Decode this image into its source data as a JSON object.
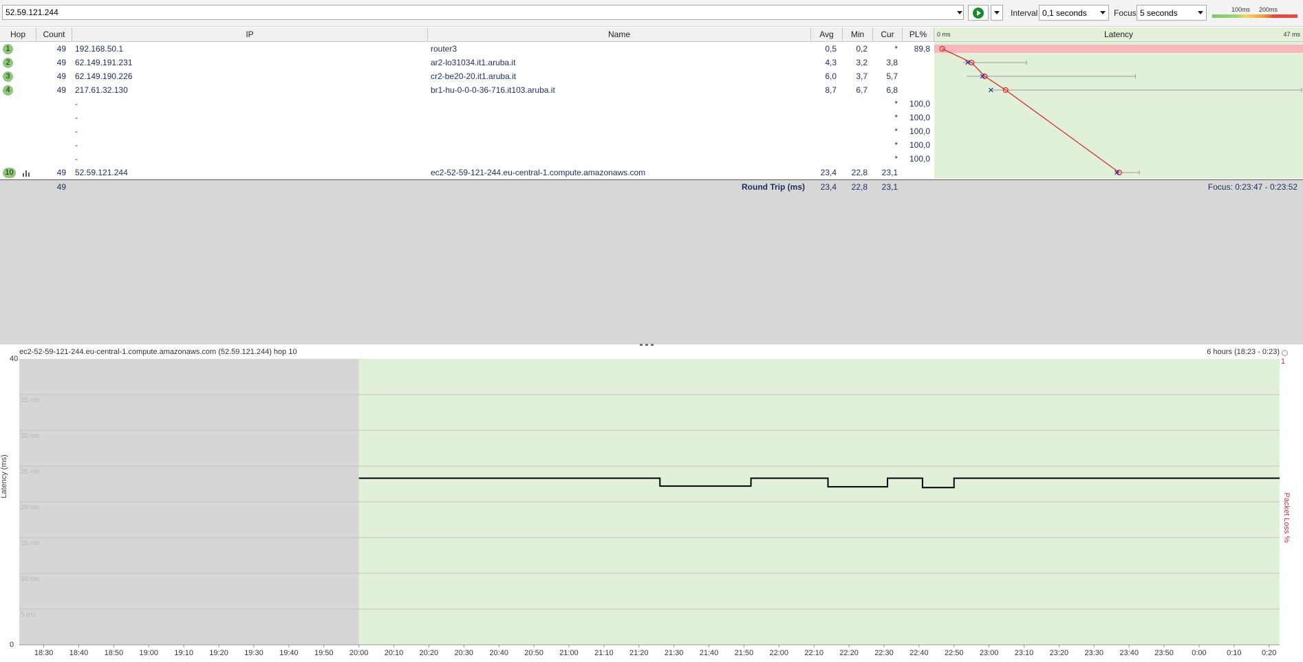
{
  "toolbar": {
    "target": "52.59.121.244",
    "interval_label": "Interval",
    "interval_value": "0,1 seconds",
    "focus_label": "Focus",
    "focus_value": "5 seconds",
    "scale_100": "100ms",
    "scale_200": "200ms",
    "play_icon": "play-icon"
  },
  "table": {
    "headers": {
      "hop": "Hop",
      "count": "Count",
      "ip": "IP",
      "name": "Name",
      "avg": "Avg",
      "min": "Min",
      "cur": "Cur",
      "pl": "PL%",
      "latency": "Latency"
    },
    "latency_scale_min": "0 ms",
    "latency_scale_max": "47 ms",
    "rows": [
      {
        "hop": "1",
        "count": "49",
        "ip": "192.168.50.1",
        "name": "router3",
        "avg": "0,5",
        "min": "0,2",
        "cur": "*",
        "pl": "89,8"
      },
      {
        "hop": "2",
        "count": "49",
        "ip": "62.149.191.231",
        "name": "ar2-lo31034.it1.aruba.it",
        "avg": "4,3",
        "min": "3,2",
        "cur": "3,8",
        "pl": ""
      },
      {
        "hop": "3",
        "count": "49",
        "ip": "62.149.190.226",
        "name": "cr2-be20-20.it1.aruba.it",
        "avg": "6,0",
        "min": "3,7",
        "cur": "5,7",
        "pl": ""
      },
      {
        "hop": "4",
        "count": "49",
        "ip": "217.61.32.130",
        "name": "br1-hu-0-0-0-36-716.it103.aruba.it",
        "avg": "8,7",
        "min": "6,7",
        "cur": "6,8",
        "pl": ""
      },
      {
        "hop": "",
        "count": "",
        "ip": "-",
        "name": "",
        "avg": "",
        "min": "",
        "cur": "*",
        "pl": "100,0"
      },
      {
        "hop": "",
        "count": "",
        "ip": "-",
        "name": "",
        "avg": "",
        "min": "",
        "cur": "*",
        "pl": "100,0"
      },
      {
        "hop": "",
        "count": "",
        "ip": "-",
        "name": "",
        "avg": "",
        "min": "",
        "cur": "*",
        "pl": "100,0"
      },
      {
        "hop": "",
        "count": "",
        "ip": "-",
        "name": "",
        "avg": "",
        "min": "",
        "cur": "*",
        "pl": "100,0"
      },
      {
        "hop": "",
        "count": "",
        "ip": "-",
        "name": "",
        "avg": "",
        "min": "",
        "cur": "*",
        "pl": "100,0"
      },
      {
        "hop": "10",
        "count": "49",
        "ip": "52.59.121.244",
        "name": "ec2-52-59-121-244.eu-central-1.compute.amazonaws.com",
        "avg": "23,4",
        "min": "22,8",
        "cur": "23,1",
        "pl": ""
      }
    ],
    "summary": {
      "count": "49",
      "label": "Round Trip (ms)",
      "avg": "23,4",
      "min": "22,8",
      "cur": "23,1",
      "focus": "Focus: 0:23:47 - 0:23:52"
    }
  },
  "chart": {
    "title": "ec2-52-59-121-244.eu-central-1.compute.amazonaws.com (52.59.121.244) hop 10",
    "range": "6 hours (18:23 - 0:23)",
    "ylabel": "Latency (ms)",
    "y2label": "Packet Loss %",
    "y2max": "1",
    "ytick_labels": [
      "0",
      "5 ms",
      "10 ms",
      "15 ms",
      "20 ms",
      "25 ms",
      "30 ms",
      "35 ms",
      "40"
    ],
    "xtick_labels": [
      "18:30",
      "18:40",
      "18:50",
      "19:00",
      "19:10",
      "19:20",
      "19:30",
      "19:40",
      "19:50",
      "20:00",
      "20:10",
      "20:20",
      "20:30",
      "20:40",
      "20:50",
      "21:00",
      "21:10",
      "21:20",
      "21:30",
      "21:40",
      "21:50",
      "22:00",
      "22:10",
      "22:20",
      "22:30",
      "22:40",
      "22:50",
      "23:00",
      "23:10",
      "23:20",
      "23:30",
      "23:40",
      "23:50",
      "0:00",
      "0:10",
      "0:20"
    ]
  },
  "chart_data": {
    "type": "line",
    "title": "ec2-52-59-121-244.eu-central-1.compute.amazonaws.com (52.59.121.244) hop 10",
    "xlabel": "",
    "ylabel": "Latency (ms)",
    "y2label": "Packet Loss %",
    "ylim": [
      0,
      40
    ],
    "y2lim": [
      0,
      1
    ],
    "xlim": [
      "18:23",
      "0:23"
    ],
    "no_data_until": "20:00",
    "series": [
      {
        "x": [
          "20:00",
          "21:26",
          "21:26",
          "21:52",
          "21:52",
          "22:14",
          "22:14",
          "22:31",
          "22:31",
          "22:41",
          "22:41",
          "22:50",
          "22:50",
          "0:23"
        ],
        "values": [
          23.3,
          23.3,
          22.2,
          22.2,
          23.3,
          23.3,
          22.1,
          22.1,
          23.3,
          23.3,
          22.0,
          22.0,
          23.3,
          23.3
        ]
      }
    ],
    "hop_latency_panel": {
      "xlim": [
        0,
        47
      ],
      "hops": [
        {
          "hop": 1,
          "avg": 0.5,
          "min": 0.2,
          "cur": null,
          "loss": 89.8
        },
        {
          "hop": 2,
          "avg": 4.3,
          "min": 3.2,
          "cur": 3.8,
          "max": 11.4
        },
        {
          "hop": 3,
          "avg": 6.0,
          "min": 3.7,
          "cur": 5.7,
          "max": 25.5
        },
        {
          "hop": 4,
          "avg": 8.7,
          "min": 6.7,
          "cur": 6.8,
          "max": 47
        },
        {
          "hop": 10,
          "avg": 23.4,
          "min": 22.8,
          "cur": 23.1,
          "max": 26.0
        }
      ]
    }
  },
  "colors": {
    "green_bg": "#e1f0d8",
    "loss_red": "#f8b7bd",
    "line_red": "#e0262b",
    "cross_blue": "#1c2bb0",
    "hop_green": "#8cc77a"
  }
}
